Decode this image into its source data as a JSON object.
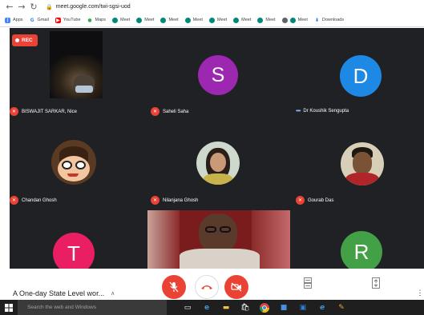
{
  "browser": {
    "url": "meet.google.com/twi-sgsi-uod",
    "bookmarks": [
      "Apps",
      "Gmail",
      "YouTube",
      "Maps",
      "Meet",
      "Meet",
      "Meet",
      "Meet",
      "Meet",
      "Meet",
      "Meet",
      "Meet",
      "Downloads"
    ]
  },
  "meet": {
    "rec_label": "REC",
    "participants": [
      {
        "name": "BISWAJIT SARKAR, Nice",
        "status": "muted"
      },
      {
        "name": "Saheli Saha",
        "avatar_letter": "S",
        "avatar_color": "#9c27b0",
        "status": "muted"
      },
      {
        "name": "Dr Koushik Sengupta",
        "avatar_letter": "D",
        "avatar_color": "#1e88e5",
        "status": "speaking"
      },
      {
        "name": "Chandan Ghosh",
        "status": "muted"
      },
      {
        "name": "Nilanjana Ghosh",
        "status": "muted"
      },
      {
        "name": "Gourab Das",
        "status": "muted"
      },
      {
        "avatar_letter": "T",
        "avatar_color": "#e91e63"
      },
      {
        "avatar_letter": "R",
        "avatar_color": "#43a047"
      }
    ]
  },
  "bottombar": {
    "meeting_title": "A One-day State Level wor..."
  },
  "taskbar": {
    "search_placeholder": "Search the web and Windows"
  },
  "colors": {
    "meet_bg": "#202124",
    "mute_red": "#ea4335",
    "accent_blue": "#8ab4f8"
  }
}
